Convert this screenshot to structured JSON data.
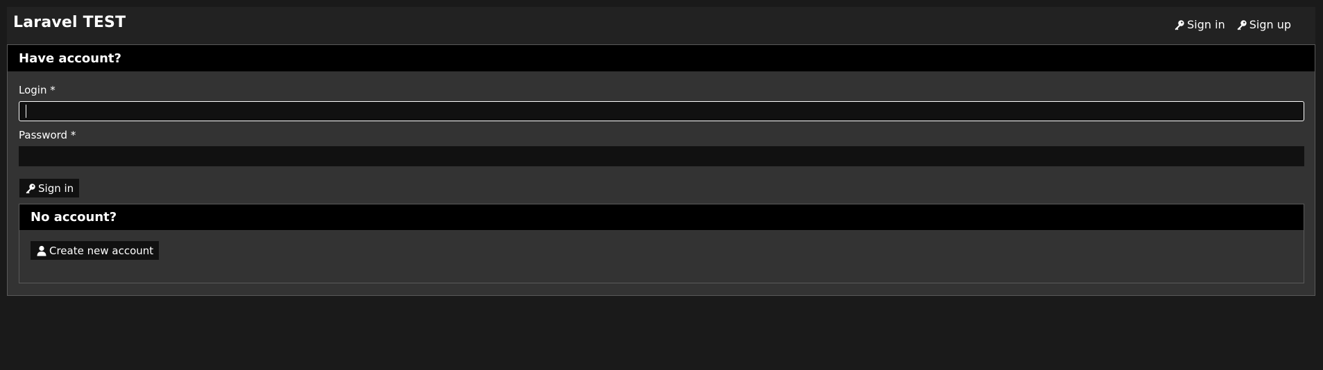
{
  "navbar": {
    "brand": "Laravel TEST",
    "links": [
      {
        "label": "Sign in",
        "icon": "key-icon"
      },
      {
        "label": "Sign up",
        "icon": "key-icon"
      }
    ]
  },
  "login_panel": {
    "heading": "Have account?",
    "login_label": "Login *",
    "login_value": "",
    "password_label": "Password *",
    "password_value": "",
    "submit_label": "Sign in",
    "submit_icon": "key-icon"
  },
  "register_panel": {
    "heading": "No account?",
    "create_label": "Create new account",
    "create_icon": "user-icon"
  },
  "colors": {
    "page_bg": "#1a1a1a",
    "navbar_bg": "#222222",
    "panel_bg": "#333333",
    "heading_bg": "#000000",
    "input_bg": "#111111",
    "text": "#ffffff"
  }
}
